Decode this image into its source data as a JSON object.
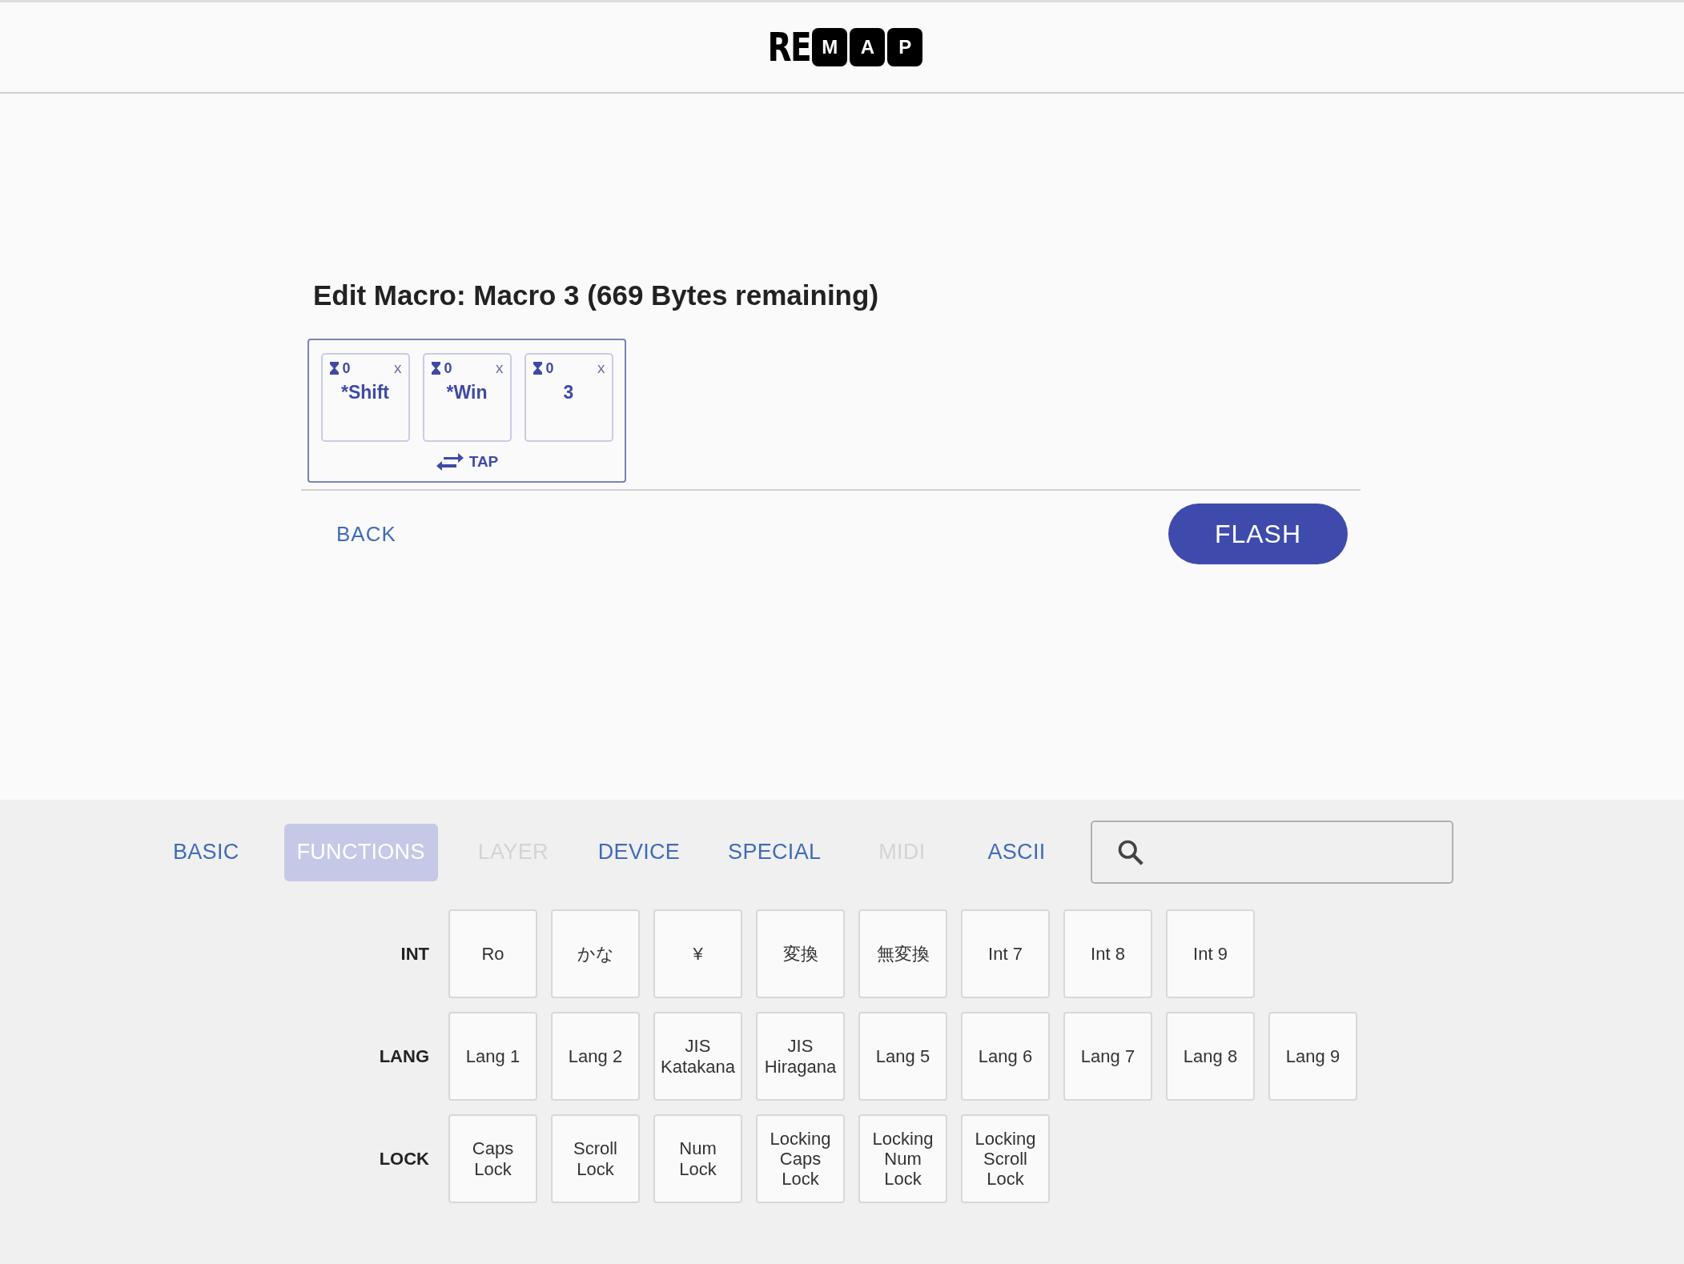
{
  "header": {
    "logo_plain": "RE",
    "logo_boxed": [
      "M",
      "A",
      "P"
    ]
  },
  "title": "Edit Macro: Macro 3 (669 Bytes remaining)",
  "macro": {
    "keys": [
      {
        "delay": "0",
        "label": "*Shift",
        "close": "x"
      },
      {
        "delay": "0",
        "label": "*Win",
        "close": "x"
      },
      {
        "delay": "0",
        "label": "3",
        "close": "x"
      }
    ],
    "mode": "TAP"
  },
  "actions": {
    "back": "BACK",
    "flash": "FLASH"
  },
  "tabs": [
    {
      "label": "BASIC",
      "selected": false,
      "disabled": false
    },
    {
      "label": "FUNCTIONS",
      "selected": true,
      "disabled": false
    },
    {
      "label": "LAYER",
      "selected": false,
      "disabled": true
    },
    {
      "label": "DEVICE",
      "selected": false,
      "disabled": false
    },
    {
      "label": "SPECIAL",
      "selected": false,
      "disabled": false
    },
    {
      "label": "MIDI",
      "selected": false,
      "disabled": true
    },
    {
      "label": "ASCII",
      "selected": false,
      "disabled": false
    }
  ],
  "groups": [
    {
      "label": "INT",
      "keys": [
        "Ro",
        "かな",
        "¥",
        "変換",
        "無変換",
        "Int 7",
        "Int 8",
        "Int 9"
      ]
    },
    {
      "label": "LANG",
      "keys": [
        "Lang 1",
        "Lang 2",
        "JIS\nKatakana",
        "JIS\nHiragana",
        "Lang 5",
        "Lang 6",
        "Lang 7",
        "Lang 8",
        "Lang 9"
      ]
    },
    {
      "label": "LOCK",
      "keys": [
        "Caps\nLock",
        "Scroll\nLock",
        "Num\nLock",
        "Locking\nCaps\nLock",
        "Locking\nNum\nLock",
        "Locking\nScroll\nLock"
      ]
    }
  ]
}
